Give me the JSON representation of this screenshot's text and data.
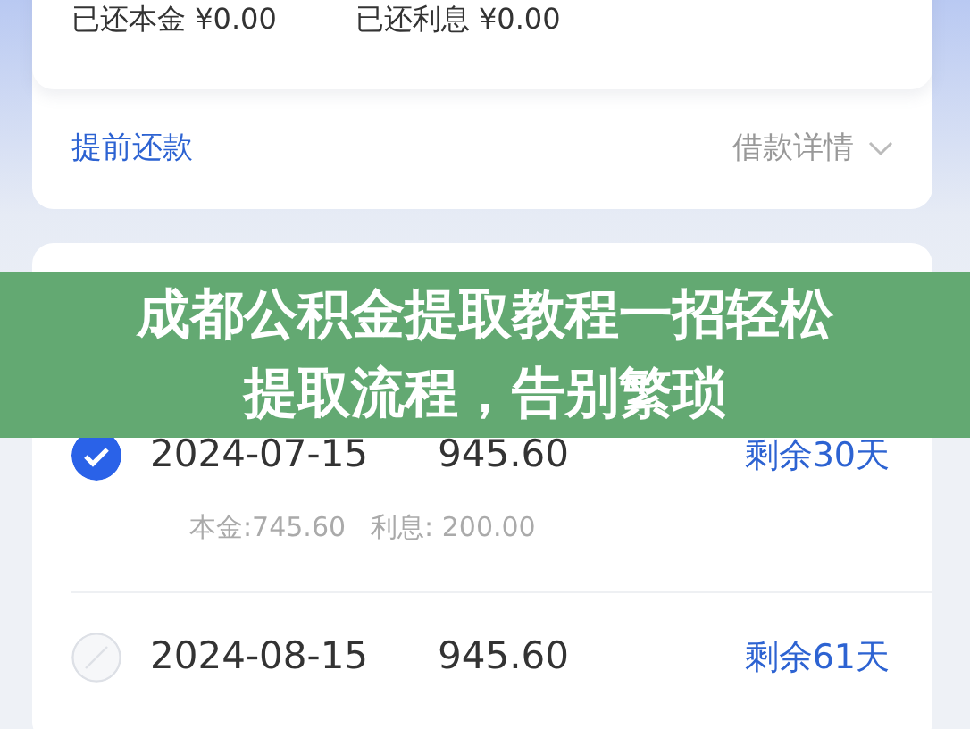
{
  "summary_card": {
    "paid_principal": "已还本金 ¥0.00",
    "paid_interest": "已还利息 ¥0.00",
    "prepay_link": "提前还款",
    "details_link": "借款详情"
  },
  "repayment_card": {
    "rows": [
      {
        "date": "2024-07-15",
        "amount": "945.60",
        "remaining": "剩余30天",
        "checked": true,
        "principal": "本金:745.60",
        "interest": "利息: 200.00"
      },
      {
        "date": "2024-08-15",
        "amount": "945.60",
        "remaining": "剩余61天",
        "checked": false
      }
    ]
  },
  "title_banner": {
    "lines": [
      "成都公积金提取教程一招轻松",
      "提取流程，告别繁琐"
    ]
  }
}
